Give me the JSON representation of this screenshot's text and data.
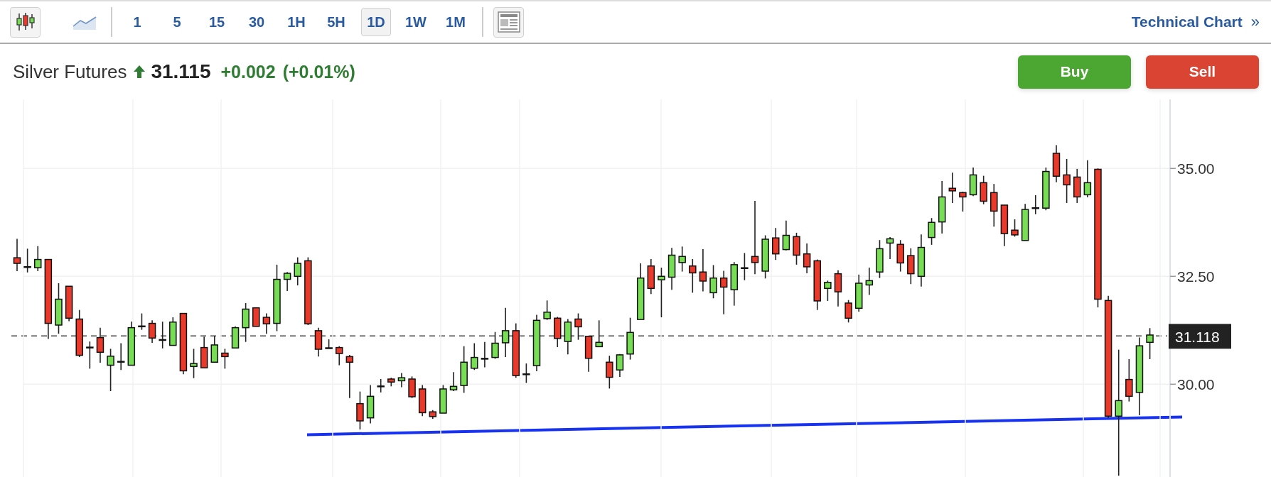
{
  "toolbar": {
    "chart_types": [
      {
        "kind": "candles",
        "selected": true
      },
      {
        "kind": "line",
        "selected": false
      }
    ],
    "intervals": [
      {
        "label": "1",
        "selected": false
      },
      {
        "label": "5",
        "selected": false
      },
      {
        "label": "15",
        "selected": false
      },
      {
        "label": "30",
        "selected": false
      },
      {
        "label": "1H",
        "selected": false
      },
      {
        "label": "5H",
        "selected": false
      },
      {
        "label": "1D",
        "selected": true
      },
      {
        "label": "1W",
        "selected": false
      },
      {
        "label": "1M",
        "selected": false
      }
    ],
    "link": {
      "label": "Technical Chart",
      "icon": "»"
    }
  },
  "quote": {
    "instrument": "Silver Futures",
    "rising": true,
    "price": "31.115",
    "change": "+0.002",
    "change_percent": "(+0.01%)",
    "buttons": [
      {
        "kind": "buy",
        "label": "Buy"
      },
      {
        "kind": "sell",
        "label": "Sell"
      }
    ]
  },
  "chart": {
    "chart_data": {
      "type": "candlestick",
      "ylim": [
        27.85,
        36.6
      ],
      "yticks": [
        {
          "value": 35,
          "label": "35.00"
        },
        {
          "value": 32.5,
          "label": "32.50"
        },
        {
          "value": 30,
          "label": "30.00"
        }
      ],
      "ohlc": [
        [
          32.93,
          33.37,
          32.62,
          32.8
        ],
        [
          32.72,
          33.14,
          32.59,
          32.71
        ],
        [
          32.7,
          33.2,
          32.62,
          32.89
        ],
        [
          32.89,
          32.89,
          31.05,
          31.41
        ],
        [
          31.37,
          32.34,
          31.17,
          31.97
        ],
        [
          32.27,
          32.27,
          31.46,
          31.53
        ],
        [
          31.51,
          31.72,
          30.63,
          30.67
        ],
        [
          30.85,
          30.99,
          30.36,
          30.85
        ],
        [
          31.08,
          31.31,
          30.5,
          30.74
        ],
        [
          30.44,
          30.82,
          29.84,
          30.65
        ],
        [
          30.52,
          30.95,
          30.33,
          30.52
        ],
        [
          30.44,
          31.45,
          30.44,
          31.31
        ],
        [
          31.34,
          31.64,
          31.26,
          31.34
        ],
        [
          31.41,
          31.48,
          30.96,
          31.07
        ],
        [
          31.03,
          31.45,
          30.83,
          31.02
        ],
        [
          30.9,
          31.55,
          30.9,
          31.44
        ],
        [
          31.64,
          31.64,
          30.23,
          30.31
        ],
        [
          30.41,
          30.82,
          30.14,
          30.48
        ],
        [
          30.85,
          31.1,
          30.38,
          30.38
        ],
        [
          30.51,
          31.12,
          30.51,
          30.91
        ],
        [
          30.72,
          30.82,
          30.36,
          30.64
        ],
        [
          30.84,
          31.34,
          30.84,
          31.31
        ],
        [
          31.31,
          31.88,
          30.98,
          31.74
        ],
        [
          31.77,
          31.77,
          31.34,
          31.34
        ],
        [
          31.55,
          31.64,
          31.17,
          31.4
        ],
        [
          31.41,
          32.77,
          31.23,
          32.43
        ],
        [
          32.43,
          32.6,
          32.16,
          32.57
        ],
        [
          32.5,
          32.94,
          32.29,
          32.8
        ],
        [
          32.86,
          32.94,
          31.37,
          31.4
        ],
        [
          31.24,
          31.31,
          30.64,
          30.81
        ],
        [
          30.84,
          31.04,
          30.83,
          30.83
        ],
        [
          30.85,
          30.88,
          30.44,
          30.71
        ],
        [
          30.64,
          30.68,
          29.68,
          30.51
        ],
        [
          29.55,
          29.83,
          28.95,
          29.15
        ],
        [
          29.22,
          29.98,
          29.09,
          29.72
        ],
        [
          29.95,
          30.12,
          29.81,
          29.95
        ],
        [
          30.12,
          30.15,
          29.95,
          30.05
        ],
        [
          30.08,
          30.26,
          29.93,
          30.15
        ],
        [
          30.12,
          30.18,
          29.68,
          29.71
        ],
        [
          29.89,
          29.98,
          29.26,
          29.34
        ],
        [
          29.36,
          29.4,
          29.2,
          29.25
        ],
        [
          29.33,
          29.98,
          29.33,
          29.89
        ],
        [
          29.87,
          30.28,
          29.84,
          29.95
        ],
        [
          29.97,
          30.88,
          29.8,
          30.51
        ],
        [
          30.37,
          30.95,
          30.33,
          30.62
        ],
        [
          30.59,
          30.98,
          30.39,
          30.59
        ],
        [
          30.62,
          31.21,
          30.59,
          30.95
        ],
        [
          30.96,
          31.77,
          30.63,
          31.24
        ],
        [
          31.24,
          31.41,
          30.15,
          30.2
        ],
        [
          30.23,
          30.48,
          30.03,
          30.23
        ],
        [
          30.43,
          31.61,
          30.3,
          31.48
        ],
        [
          31.52,
          31.94,
          31.49,
          31.67
        ],
        [
          31.53,
          31.56,
          30.86,
          31.06
        ],
        [
          30.99,
          31.51,
          30.69,
          31.44
        ],
        [
          31.51,
          31.64,
          31.03,
          31.33
        ],
        [
          31.11,
          31.11,
          30.29,
          30.6
        ],
        [
          30.87,
          31.48,
          30.87,
          30.97
        ],
        [
          30.51,
          30.66,
          29.9,
          30.16
        ],
        [
          30.33,
          30.7,
          30.17,
          30.68
        ],
        [
          30.7,
          31.54,
          30.57,
          31.2
        ],
        [
          31.5,
          32.8,
          31.5,
          32.46
        ],
        [
          32.74,
          32.9,
          32.09,
          32.22
        ],
        [
          32.42,
          32.7,
          31.55,
          32.5
        ],
        [
          32.48,
          33.16,
          32.19,
          32.99
        ],
        [
          32.82,
          33.19,
          32.61,
          32.96
        ],
        [
          32.74,
          32.9,
          32.12,
          32.58
        ],
        [
          32.6,
          33.13,
          32.15,
          32.39
        ],
        [
          32.12,
          32.76,
          31.99,
          32.46
        ],
        [
          32.46,
          32.63,
          31.62,
          32.25
        ],
        [
          32.19,
          32.83,
          31.82,
          32.77
        ],
        [
          32.69,
          33.04,
          32.41,
          32.69
        ],
        [
          32.96,
          34.25,
          32.55,
          32.82
        ],
        [
          32.62,
          33.45,
          32.45,
          33.36
        ],
        [
          33.39,
          33.62,
          32.88,
          33.02
        ],
        [
          33.12,
          33.79,
          33.1,
          33.45
        ],
        [
          33.42,
          33.51,
          32.77,
          32.99
        ],
        [
          33.02,
          33.26,
          32.57,
          32.72
        ],
        [
          32.86,
          32.89,
          31.72,
          31.93
        ],
        [
          32.22,
          32.4,
          31.93,
          32.36
        ],
        [
          32.56,
          32.64,
          31.8,
          32.14
        ],
        [
          31.88,
          31.95,
          31.43,
          31.53
        ],
        [
          31.76,
          32.54,
          31.68,
          32.34
        ],
        [
          32.3,
          32.7,
          32.07,
          32.4
        ],
        [
          32.6,
          33.34,
          32.46,
          33.14
        ],
        [
          33.27,
          33.41,
          32.9,
          33.37
        ],
        [
          33.24,
          33.34,
          32.61,
          32.81
        ],
        [
          32.98,
          33.15,
          32.32,
          32.56
        ],
        [
          32.5,
          33.47,
          32.26,
          33.17
        ],
        [
          33.4,
          33.85,
          33.23,
          33.75
        ],
        [
          33.76,
          34.71,
          33.49,
          34.34
        ],
        [
          34.54,
          34.9,
          34.2,
          34.48
        ],
        [
          34.44,
          34.46,
          34.0,
          34.34
        ],
        [
          34.39,
          35.02,
          34.36,
          34.85
        ],
        [
          34.67,
          34.83,
          34.17,
          34.24
        ],
        [
          34.44,
          34.64,
          33.65,
          34.01
        ],
        [
          34.15,
          34.15,
          33.2,
          33.49
        ],
        [
          33.57,
          33.82,
          33.42,
          33.46
        ],
        [
          33.33,
          34.18,
          33.33,
          34.05
        ],
        [
          34.08,
          34.38,
          33.94,
          34.08
        ],
        [
          34.08,
          35.02,
          34.03,
          34.93
        ],
        [
          35.35,
          35.54,
          34.68,
          34.82
        ],
        [
          34.85,
          35.22,
          34.2,
          34.62
        ],
        [
          34.8,
          34.99,
          34.2,
          34.34
        ],
        [
          34.39,
          35.19,
          34.33,
          34.67
        ],
        [
          34.98,
          35.0,
          31.78,
          31.97
        ],
        [
          31.94,
          32.05,
          29.22,
          29.26
        ],
        [
          29.26,
          30.8,
          27.88,
          29.62
        ],
        [
          30.11,
          30.58,
          29.6,
          29.72
        ],
        [
          29.81,
          31.08,
          29.28,
          30.89
        ],
        [
          30.97,
          31.3,
          30.58,
          31.14
        ]
      ],
      "grid": true
    },
    "price_marker": "31.118"
  }
}
